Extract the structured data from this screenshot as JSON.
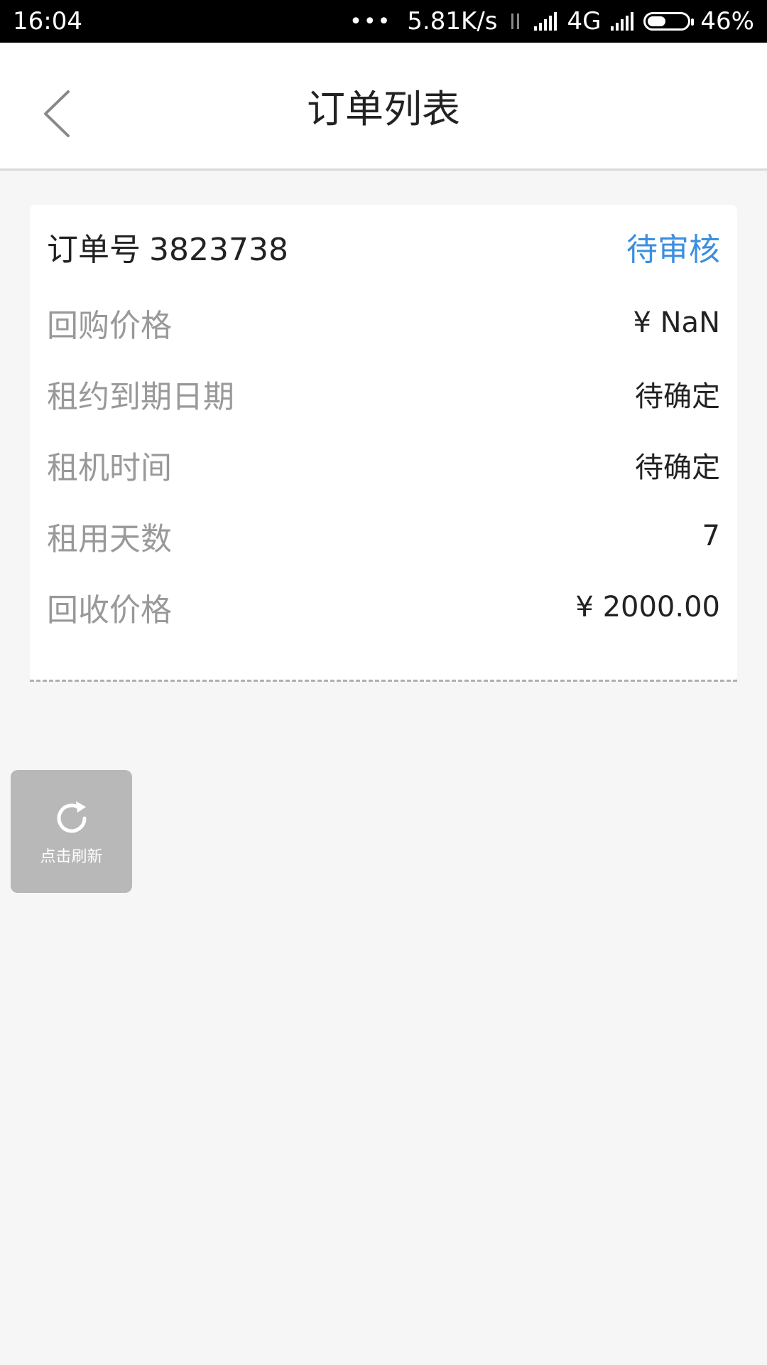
{
  "status_bar": {
    "time": "16:04",
    "dots": "•••",
    "net_speed": "5.81K/s",
    "network_type": "4G",
    "battery_percent": "46%",
    "battery_level": 0.46
  },
  "header": {
    "title": "订单列表",
    "back_icon": "chevron-left-icon"
  },
  "order": {
    "number_label": "订单号",
    "number": "3823738",
    "status": "待审核",
    "status_color": "#3b8ee0",
    "details": [
      {
        "label": "回购价格",
        "value": "¥ NaN"
      },
      {
        "label": "租约到期日期",
        "value": "待确定"
      },
      {
        "label": "租机时间",
        "value": "待确定"
      },
      {
        "label": "租用天数",
        "value": "7"
      },
      {
        "label": "回收价格",
        "value": "¥ 2000.00"
      }
    ]
  },
  "refresh": {
    "icon": "refresh-icon",
    "label": "点击刷新"
  }
}
